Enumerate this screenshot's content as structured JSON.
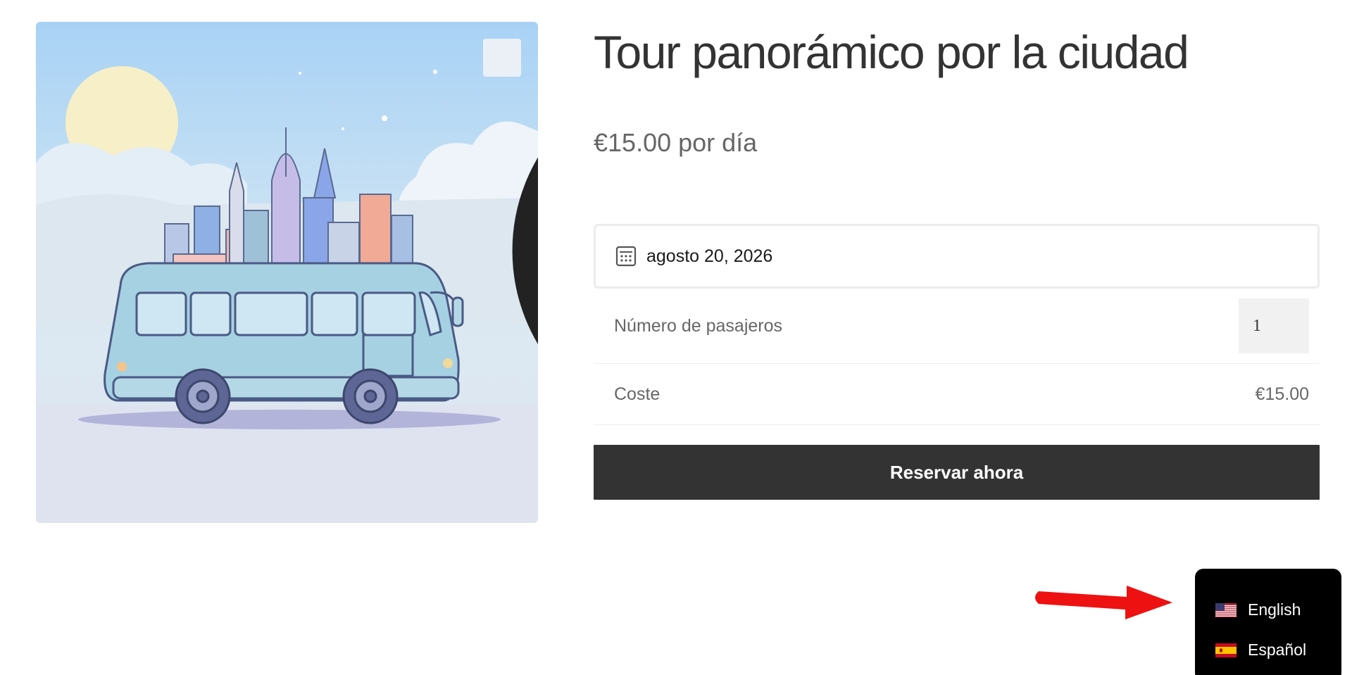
{
  "product": {
    "title": "Tour panorámico por la ciudad",
    "price": "€15.00 por día",
    "image_alt": "City bus illustration"
  },
  "booking": {
    "date_value": "agosto 20, 2026",
    "passengers_label": "Número de pasajeros",
    "passengers_value": "1",
    "cost_label": "Coste",
    "cost_value": "€15.00",
    "book_button": "Reservar ahora"
  },
  "language_switcher": {
    "items": [
      {
        "label": "English",
        "flag": "us-flag-icon"
      },
      {
        "label": "Español",
        "flag": "es-flag-icon"
      }
    ]
  },
  "colors": {
    "button_bg": "#333333",
    "annotation_arrow": "#ee1111",
    "switcher_bg": "#000000"
  }
}
